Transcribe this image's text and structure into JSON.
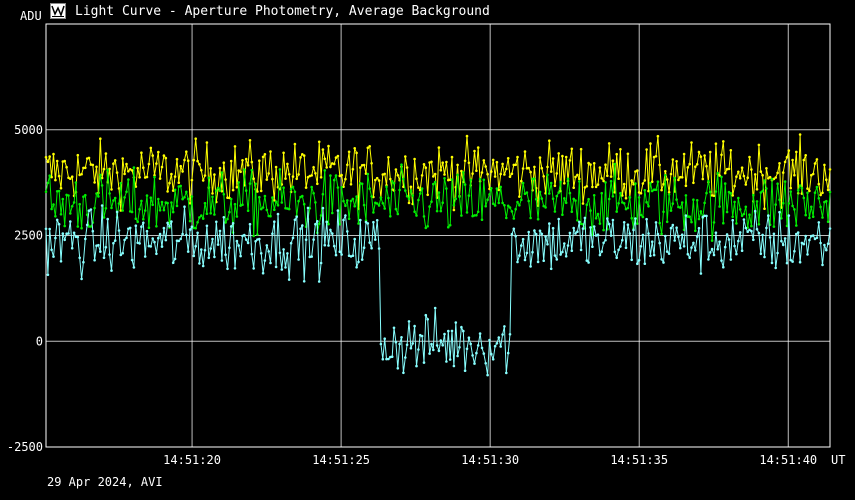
{
  "window": {
    "title": "Light Curve - Aperture Photometry, Average Background",
    "icon": "light-curve-app-icon"
  },
  "footer": {
    "caption": "29 Apr 2024, AVI"
  },
  "colors": {
    "background": "#000000",
    "grid": "#ffffff",
    "series_yellow": "#ffff00",
    "series_green": "#00ee00",
    "series_cyan": "#88ffff"
  },
  "chart_data": {
    "type": "line",
    "title": "Light Curve - Aperture Photometry, Average Background",
    "xlabel": "UT",
    "ylabel": "ADU",
    "x_range": [
      "14:51:15.1",
      "14:51:41.4"
    ],
    "ylim": [
      -2500,
      7500
    ],
    "yticks": [
      -2500,
      0,
      2500,
      5000
    ],
    "xticks": [
      "14:51:20",
      "14:51:25",
      "14:51:30",
      "14:51:35",
      "14:51:40"
    ],
    "grid": true,
    "legend": "none",
    "series": [
      {
        "color": "#ffff00",
        "mean": 4000,
        "noise": 350,
        "points": 420
      },
      {
        "color": "#00ee00",
        "mean": 3250,
        "noise": 380,
        "points": 420
      },
      {
        "color": "#88ffff",
        "mean": 2350,
        "noise": 380,
        "points": 420,
        "dip": {
          "from": "14:51:26.3",
          "to": "14:51:30.7",
          "level": -50
        }
      }
    ]
  }
}
